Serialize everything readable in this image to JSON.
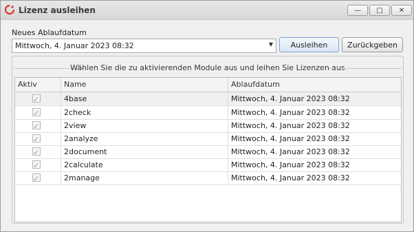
{
  "window": {
    "title": "Lizenz ausleihen",
    "controls": {
      "minimize": "—",
      "maximize": "□",
      "close": "✕"
    }
  },
  "form": {
    "date_label": "Neues Ablaufdatum",
    "date_value": "Mittwoch, 4. Januar 2023 08:32",
    "lend_button": "Ausleihen",
    "return_button": "Zurückgeben"
  },
  "group": {
    "caption": "Wählen Sie die zu aktivierenden Module aus und leihen Sie Lizenzen aus"
  },
  "table": {
    "columns": [
      "Aktiv",
      "Name",
      "Ablaufdatum"
    ],
    "rows": [
      {
        "active": true,
        "name": "4base",
        "expiry": "Mittwoch, 4. Januar 2023 08:32"
      },
      {
        "active": true,
        "name": "2check",
        "expiry": "Mittwoch, 4. Januar 2023 08:32"
      },
      {
        "active": true,
        "name": "2view",
        "expiry": "Mittwoch, 4. Januar 2023 08:32"
      },
      {
        "active": true,
        "name": "2analyze",
        "expiry": "Mittwoch, 4. Januar 2023 08:32"
      },
      {
        "active": true,
        "name": "2document",
        "expiry": "Mittwoch, 4. Januar 2023 08:32"
      },
      {
        "active": true,
        "name": "2calculate",
        "expiry": "Mittwoch, 4. Januar 2023 08:32"
      },
      {
        "active": true,
        "name": "2manage",
        "expiry": "Mittwoch, 4. Januar 2023 08:32"
      }
    ]
  },
  "colors": {
    "icon_red": "#d8352a",
    "primary_border": "#7fa1cf"
  }
}
